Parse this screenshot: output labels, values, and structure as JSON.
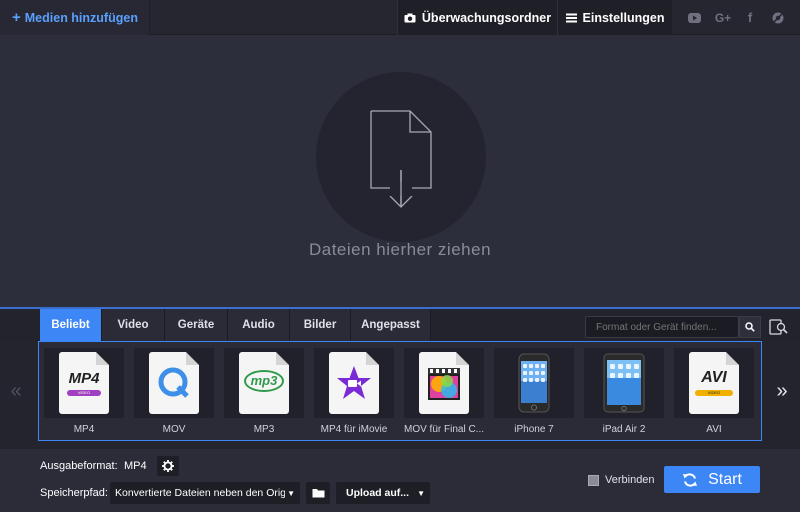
{
  "topbar": {
    "add_media_label": "Medien hinzufügen",
    "watch_folder_label": "Überwachungsordner",
    "settings_label": "Einstellungen",
    "social_icons": [
      "youtube-icon",
      "google-plus-icon",
      "facebook-icon",
      "vk-icon"
    ],
    "social_glyphs": {
      "google": "G+",
      "facebook": "f"
    }
  },
  "drop_area": {
    "text": "Dateien hierher ziehen"
  },
  "tabs": [
    {
      "label": "Beliebt",
      "active": true
    },
    {
      "label": "Video",
      "active": false
    },
    {
      "label": "Geräte",
      "active": false
    },
    {
      "label": "Audio",
      "active": false
    },
    {
      "label": "Bilder",
      "active": false
    },
    {
      "label": "Angepasst",
      "active": false
    }
  ],
  "search": {
    "placeholder": "Format oder Gerät finden..."
  },
  "nav": {
    "prev": "«",
    "next": "»"
  },
  "formats": [
    {
      "label": "MP4",
      "badge": "MP4",
      "sub": "VIDEO",
      "icon": "mp4-file-icon"
    },
    {
      "label": "MOV",
      "icon": "quicktime-file-icon"
    },
    {
      "label": "MP3",
      "badge": "mp3",
      "icon": "mp3-file-icon"
    },
    {
      "label": "MP4 für iMovie",
      "icon": "imovie-file-icon"
    },
    {
      "label": "MOV für Final C...",
      "icon": "final-cut-file-icon"
    },
    {
      "label": "iPhone 7",
      "icon": "iphone-device-icon"
    },
    {
      "label": "iPad Air 2",
      "icon": "ipad-device-icon"
    },
    {
      "label": "AVI",
      "badge": "AVI",
      "sub": "VIDEO",
      "icon": "avi-file-icon"
    }
  ],
  "output": {
    "format_label": "Ausgabeformat:",
    "format_value": "MP4",
    "path_label": "Speicherpfad:",
    "path_value": "Konvertierte Dateien neben den Originalen speichern",
    "upload_label": "Upload auf...",
    "join_label": "Verbinden",
    "join_checked": false,
    "start_label": "Start"
  },
  "colors": {
    "accent": "#3d86f5",
    "link": "#5aa0ff",
    "background": "#2c2d3a"
  }
}
